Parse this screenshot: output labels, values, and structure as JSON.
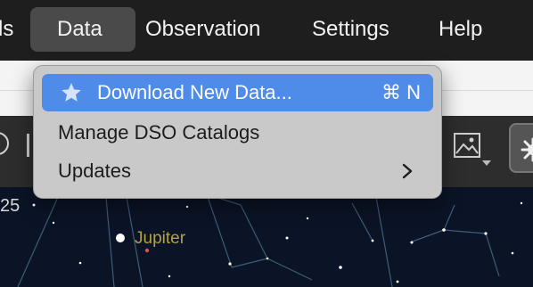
{
  "menubar": {
    "items": [
      {
        "label": "ls"
      },
      {
        "label": "Data"
      },
      {
        "label": "Observation"
      },
      {
        "label": "Settings"
      },
      {
        "label": "Help"
      }
    ],
    "active": "Data"
  },
  "dropdown": {
    "items": [
      {
        "label": "Download New Data...",
        "icon": "star-icon",
        "shortcut": "⌘ N",
        "highlighted": true
      },
      {
        "label": "Manage DSO Catalogs"
      },
      {
        "label": "Updates",
        "icon": "chevron-right-icon"
      }
    ]
  },
  "toolbar": {
    "icons": [
      "circle-icon",
      "image-icon",
      "sun-burst-icon"
    ]
  },
  "sky": {
    "number": "25",
    "object_label": "Jupiter"
  },
  "colors": {
    "menubar_bg": "#1e1e1e",
    "highlight": "#4f8be8",
    "jupiter_label": "#b5a23e"
  }
}
